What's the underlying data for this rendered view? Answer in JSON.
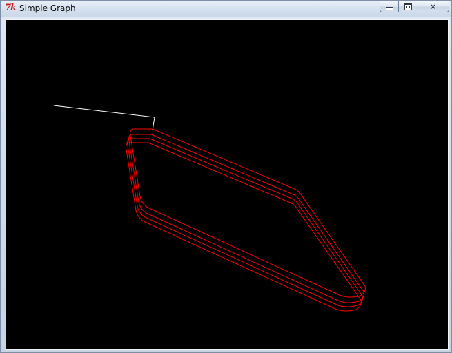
{
  "window": {
    "title": "Simple Graph",
    "app_icon_text": "7k",
    "app_icon_name": "tk-feather-icon",
    "controls": {
      "minimize_icon": "minimize-icon",
      "maximize_icon": "maximize-icon",
      "close_icon": "close-icon",
      "close_glyph": "✕"
    }
  },
  "graph": {
    "background": "#000000",
    "colors": {
      "lead_line": "#ffffff",
      "loop": "#ff0000"
    }
  }
}
